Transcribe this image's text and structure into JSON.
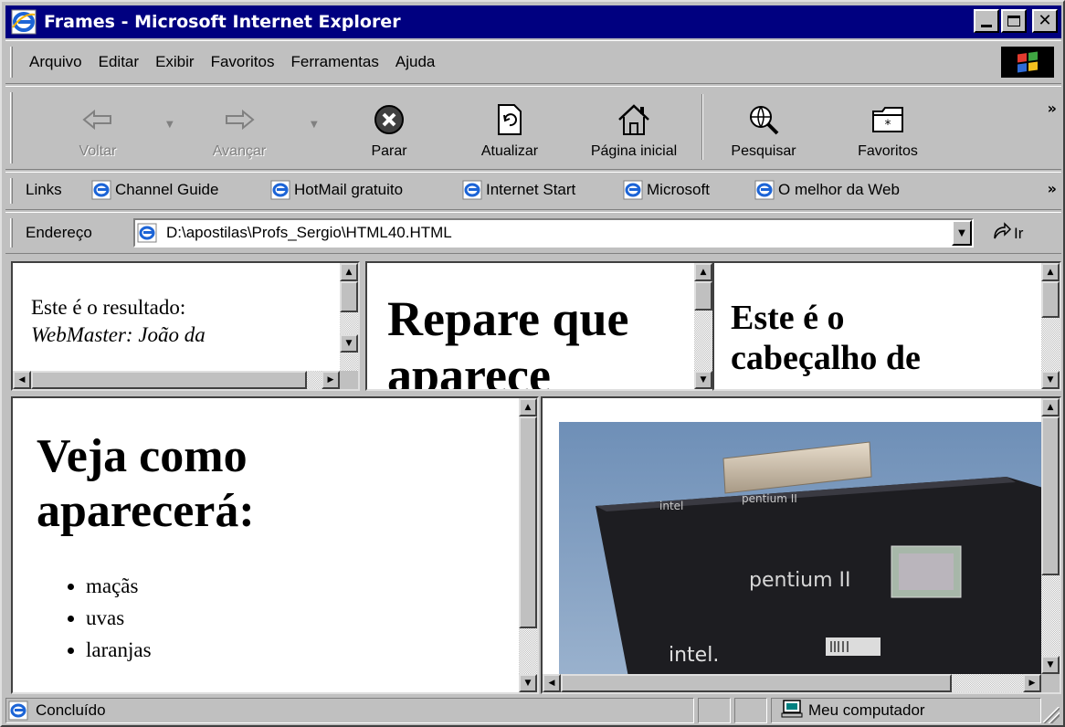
{
  "window": {
    "title": "Frames - Microsoft Internet Explorer",
    "app_icon": "ie-logo-icon"
  },
  "menu": {
    "items": [
      "Arquivo",
      "Editar",
      "Exibir",
      "Favoritos",
      "Ferramentas",
      "Ajuda"
    ]
  },
  "toolbar": {
    "back": "Voltar",
    "forward": "Avançar",
    "stop": "Parar",
    "refresh": "Atualizar",
    "home": "Página inicial",
    "search": "Pesquisar",
    "favorites": "Favoritos",
    "more": "»"
  },
  "links": {
    "label": "Links",
    "items": [
      "Channel Guide",
      "HotMail gratuito",
      "Internet Start",
      "Microsoft",
      "O melhor da Web"
    ],
    "more": "»"
  },
  "address": {
    "label": "Endereço",
    "value": "D:\\apostilas\\Profs_Sergio\\HTML40.HTML",
    "go": "Ir"
  },
  "frames": {
    "top_left": {
      "line1": "Este é o resultado:",
      "line2": "WebMaster: João da"
    },
    "top_middle": {
      "heading_line1": "Repare que",
      "heading_line2": "aparece"
    },
    "top_right": {
      "heading_line1": "Este é o",
      "heading_line2": "cabeçalho de"
    },
    "bottom_left": {
      "heading_line1": "Veja como",
      "heading_line2": "aparecerá:",
      "list": [
        "maçãs",
        "uvas",
        "laranjas"
      ]
    },
    "bottom_right": {
      "chip_brand_top": "intel",
      "chip_label_top": "pentium II",
      "chip_label_main": "pentium II",
      "chip_brand_main": "intel."
    }
  },
  "status": {
    "text": "Concluído",
    "zone": "Meu computador"
  },
  "colors": {
    "titlebar": "#000080",
    "chrome": "#c0c0c0"
  }
}
